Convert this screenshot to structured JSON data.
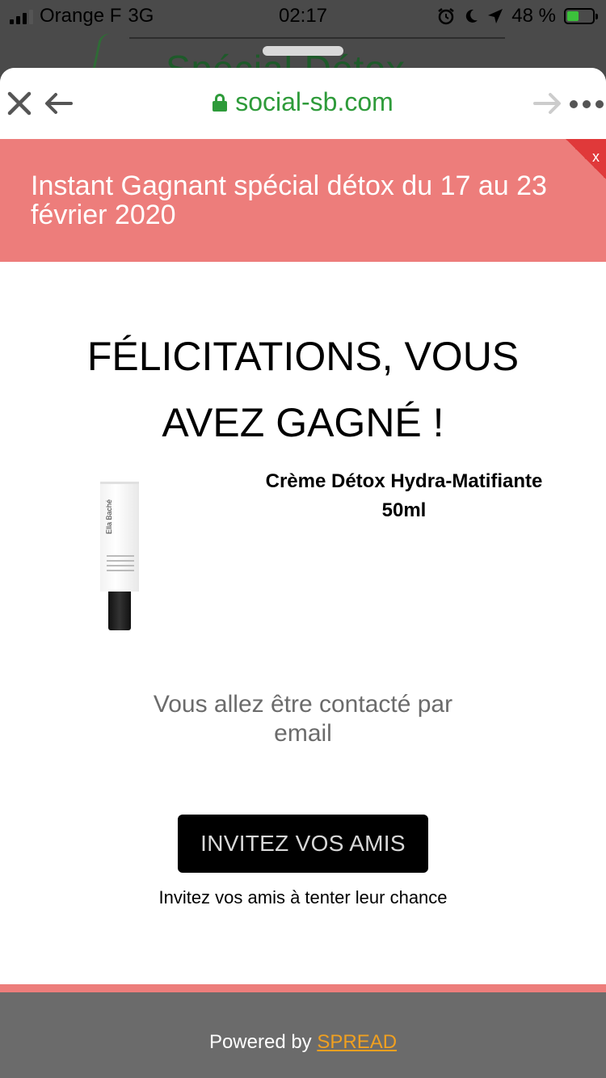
{
  "status_bar": {
    "carrier": "Orange F",
    "network": "3G",
    "time": "02:17",
    "battery": "48 %"
  },
  "browser": {
    "url": "social-sb.com",
    "icons": [
      "close-icon",
      "back-arrow-icon",
      "forward-arrow-icon",
      "more-icon",
      "lock-icon"
    ],
    "url_color": "#2e9b3a"
  },
  "background_page": {
    "title_fragment": "Spécial Détox"
  },
  "banner": {
    "text": "Instant Gagnant spécial détox du 17 au 23 février 2020",
    "close_label": "x",
    "color": "#ed7d7b"
  },
  "result": {
    "headline": "FÉLICITATIONS, VOUS AVEZ GAGNÉ !",
    "product_name": "Crème Détox Hydra-Matifiante 50ml",
    "product_brand": "Ella Baché",
    "contact_message": "Vous allez être contacté par email"
  },
  "invite": {
    "button_label": "INVITEZ VOS AMIS",
    "subtext": "Invitez vos amis à tenter leur chance"
  },
  "footer": {
    "powered_by": "Powered by",
    "brand_link": "SPREAD"
  }
}
